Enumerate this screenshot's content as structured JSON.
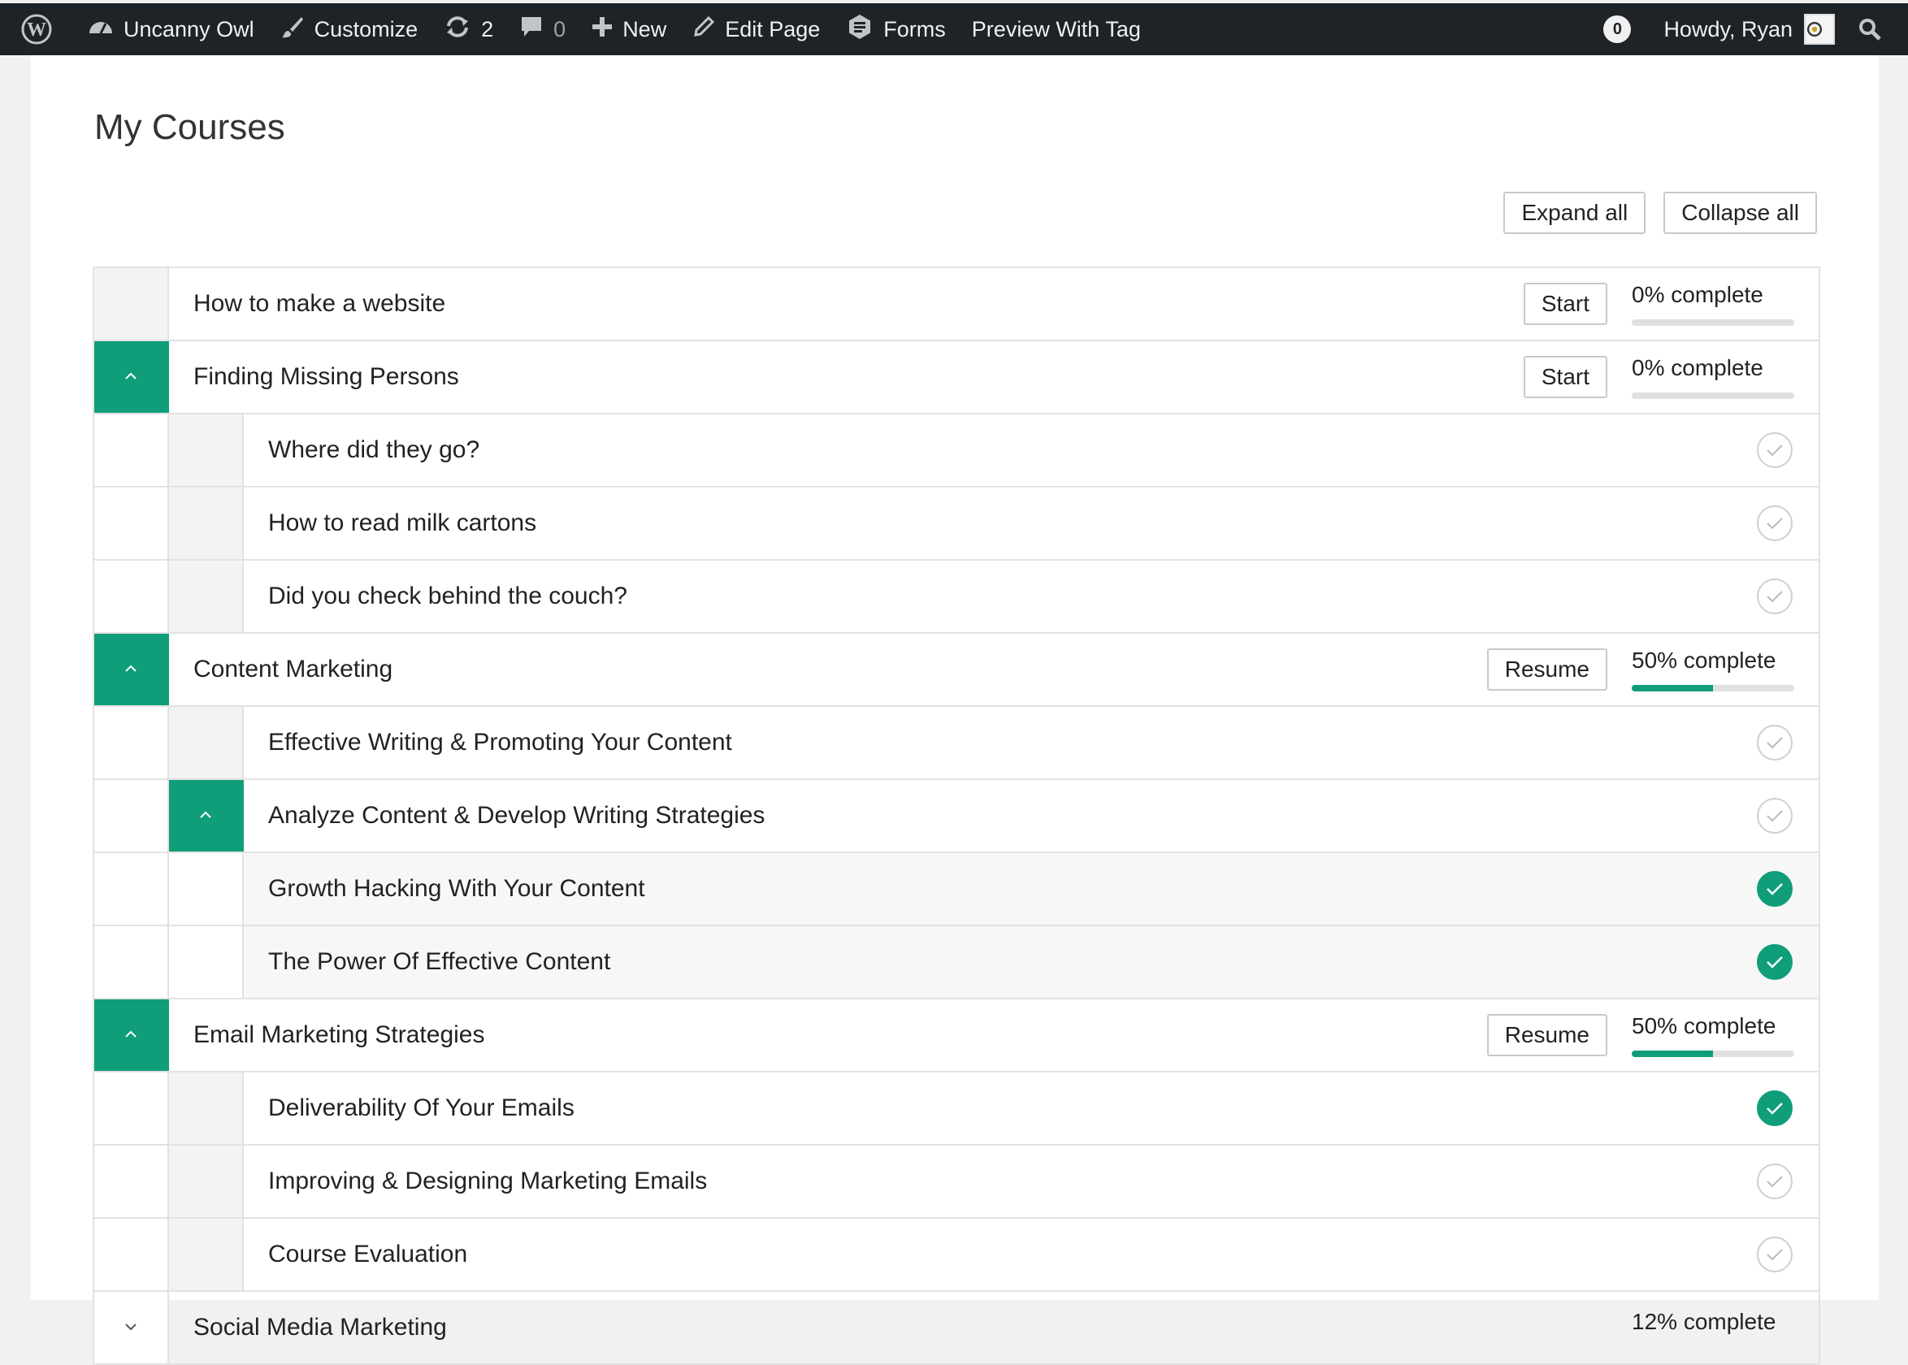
{
  "adminbar": {
    "site_name": "Uncanny Owl",
    "customize": "Customize",
    "updates_count": "2",
    "comments_count": "0",
    "new": "New",
    "edit_page": "Edit Page",
    "forms": "Forms",
    "preview": "Preview With Tag",
    "notifications": "0",
    "howdy": "Howdy, Ryan"
  },
  "page": {
    "title": "My Courses",
    "expand_all": "Expand all",
    "collapse_all": "Collapse all"
  },
  "courses": {
    "c1": {
      "title": "How to make a website",
      "action": "Start",
      "progress_label": "0% complete",
      "progress": 0
    },
    "c2": {
      "title": "Finding Missing Persons",
      "action": "Start",
      "progress_label": "0% complete",
      "progress": 0,
      "lessons": [
        "Where did they go?",
        "How to read milk cartons",
        "Did you check behind the couch?"
      ]
    },
    "c3": {
      "title": "Content Marketing",
      "action": "Resume",
      "progress_label": "50% complete",
      "progress": 50,
      "lessons": [
        "Effective Writing & Promoting Your Content",
        "Analyze Content & Develop Writing Strategies"
      ],
      "topics": [
        "Growth Hacking With Your Content",
        "The Power Of Effective Content"
      ]
    },
    "c4": {
      "title": "Email Marketing Strategies",
      "action": "Resume",
      "progress_label": "50% complete",
      "progress": 50,
      "lessons": [
        "Deliverability Of Your Emails",
        "Improving & Designing Marketing Emails",
        "Course Evaluation"
      ]
    },
    "c5": {
      "title": "Social Media Marketing",
      "progress_label": "12% complete"
    }
  },
  "colors": {
    "accent": "#0f9d7a",
    "adminbar": "#1d2327"
  }
}
